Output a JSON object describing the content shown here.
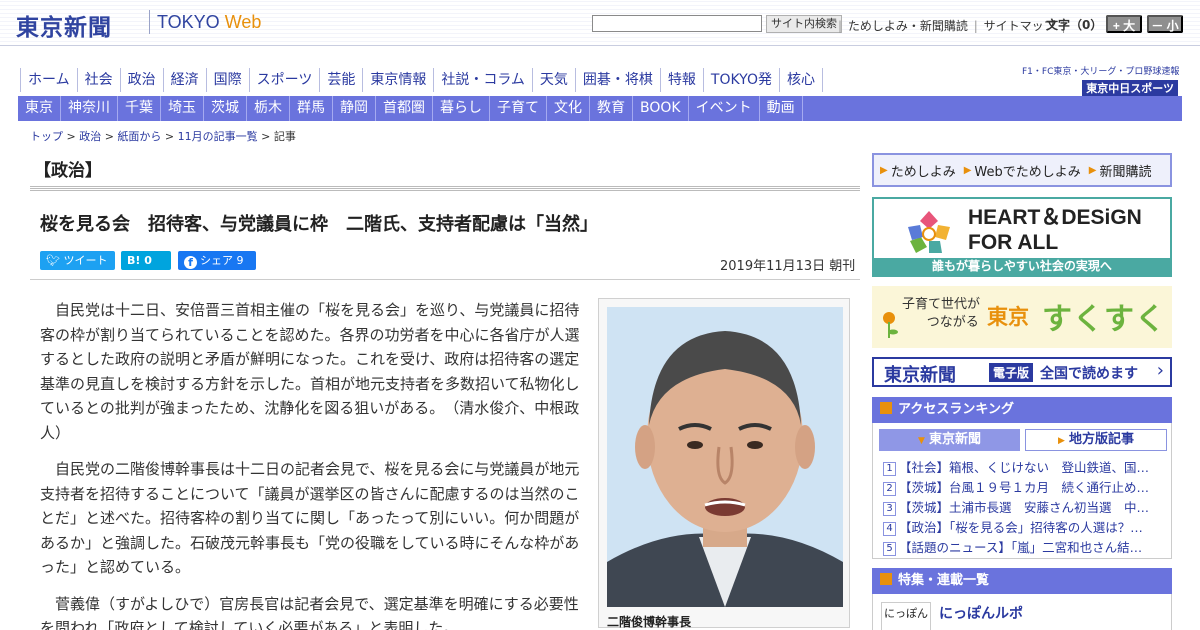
{
  "header": {
    "logo_jp": "東京新聞",
    "logo_en_a": "TOKYO ",
    "logo_en_b": "Web",
    "search_placeholder": "",
    "search_button": "サイト内検索",
    "link_trial": "ためしよみ・新聞購読",
    "link_sitemap": "サイトマップ",
    "font_label": "文字（0）",
    "font_larger": "+ 大",
    "font_smaller": "－ 小"
  },
  "main_nav": [
    "ホーム",
    "社会",
    "政治",
    "経済",
    "国際",
    "スポーツ",
    "芸能",
    "東京情報",
    "社説・コラム",
    "天気",
    "囲碁・将棋",
    "特報",
    "TOKYO発",
    "核心"
  ],
  "chunichi": {
    "line1": "F1・FC東京・大リーグ・プロ野球速報",
    "line2": "東京中日スポーツ"
  },
  "sub_nav": [
    "東京",
    "神奈川",
    "千葉",
    "埼玉",
    "茨城",
    "栃木",
    "群馬",
    "静岡",
    "首都圏",
    "暮らし",
    "子育て",
    "文化",
    "教育",
    "BOOK",
    "イベント",
    "動画"
  ],
  "breadcrumb": {
    "items": [
      "トップ",
      "政治",
      "紙面から",
      "11月の記事一覧"
    ],
    "current": "記事"
  },
  "article": {
    "section": "【政治】",
    "headline": "桜を見る会　招待客、与党議員に枠　二階氏、支持者配慮は「当然」",
    "tweet": "ツイート",
    "hatena": "B! 0",
    "share": "シェア 9",
    "date": "2019年11月13日 朝刊",
    "paragraphs": [
      "自民党は十二日、安倍晋三首相主催の「桜を見る会」を巡り、与党議員に招待客の枠が割り当てられていることを認めた。各界の功労者を中心に各省庁が人選するとした政府の説明と矛盾が鮮明になった。これを受け、政府は招待客の選定基準の見直しを検討する方針を示した。首相が地元支持者を多数招いて私物化しているとの批判が強まったため、沈静化を図る狙いがある。　（清水俊介、中根政人）",
      "自民党の二階俊博幹事長は十二日の記者会見で、桜を見る会に与党議員が地元支持者を招待することについて「議員が選挙区の皆さんに配慮するのは当然のことだ」と述べた。招待客枠の割り当てに関し「あったって別にいい。何か問題があるか」と強調した。石破茂元幹事長も「党の役職をしている時にそんな枠があった」と認めている。",
      "菅義偉（すがよしひで）官房長官は記者会見で、選定基準を明確にする必要性を問われ「政府として検討していく必要がある」と表明した。"
    ],
    "photo_caption": "二階俊博幹事長"
  },
  "sidebar": {
    "links": [
      "ためしよみ",
      "Webでためしよみ",
      "新聞購読"
    ],
    "hd_title_1": "HEART＆DESiGN",
    "hd_title_2": "FOR ALL",
    "hd_foot": "誰もが暮らしやすい社会の実現へ",
    "suku_sub_1": "子育て世代が",
    "suku_sub_2": "つながる",
    "suku_tokyo": "東京",
    "suku_main": "すくすく",
    "denshi_logo": "東京新聞",
    "denshi_badge": "電子版",
    "denshi_text": "全国で読めます",
    "ranking_title": "アクセスランキング",
    "ranking_tab1": "東京新聞",
    "ranking_tab2": "地方版記事",
    "ranking": [
      {
        "num": "1",
        "text": "【社会】箱根、くじけない　登山鉄道、国…"
      },
      {
        "num": "2",
        "text": "【茨城】台風１９号１カ月　続く通行止め…"
      },
      {
        "num": "3",
        "text": "【茨城】土浦市長選　安藤さん初当選　中…"
      },
      {
        "num": "4",
        "text": "【政治】「桜を見る会」招待客の人選は？…"
      },
      {
        "num": "5",
        "text": "【話題のニュース】「嵐」二宮和也さん結…"
      }
    ],
    "feature_title": "特集・連載一覧",
    "feature_thumb": "にっぽん",
    "feature_item": "にっぽんルポ"
  },
  "colors": {
    "brand": "#3044a0",
    "nav_bg": "#6a73dd",
    "accent": "#e8900c",
    "hd_green": "#4aa9a2"
  }
}
